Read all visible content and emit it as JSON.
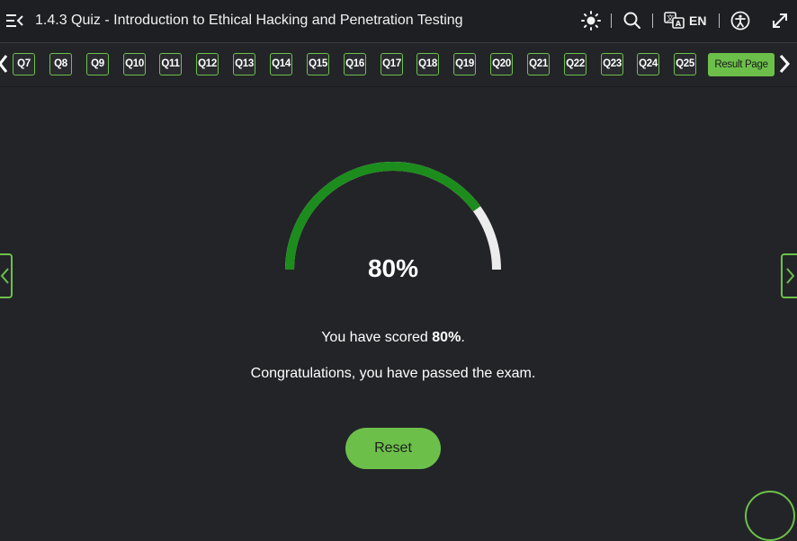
{
  "header": {
    "title": "1.4.3 Quiz - Introduction to Ethical Hacking and Penetration Testing",
    "language": "EN",
    "icons": [
      "menu-collapse-icon",
      "brightness-icon",
      "search-icon",
      "translate-icon",
      "accessibility-icon",
      "expand-icon"
    ]
  },
  "question_nav": {
    "items": [
      "Q7",
      "Q8",
      "Q9",
      "Q10",
      "Q11",
      "Q12",
      "Q13",
      "Q14",
      "Q15",
      "Q16",
      "Q17",
      "Q18",
      "Q19",
      "Q20",
      "Q21",
      "Q22",
      "Q23",
      "Q24",
      "Q25"
    ],
    "result_label": "Result Page"
  },
  "result": {
    "score_value": 80,
    "score_display": "80%",
    "score_prefix": "You have scored ",
    "score_suffix": ".",
    "message": "Congratulations, you have passed the exam.",
    "reset_label": "Reset"
  },
  "colors": {
    "accent": "#6cc04a",
    "gauge_fill": "#1c8c1c",
    "gauge_track": "#ececec",
    "background": "#232428"
  }
}
